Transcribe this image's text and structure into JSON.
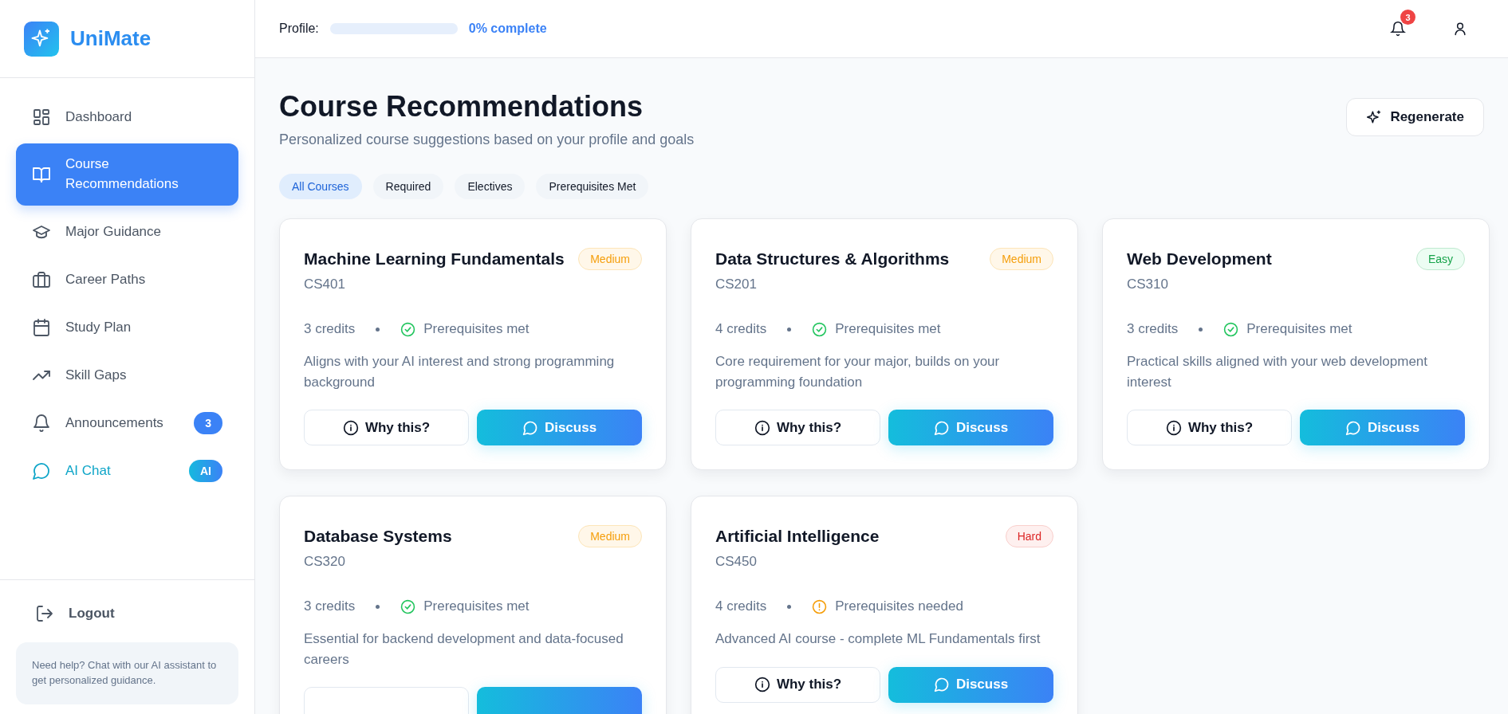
{
  "brand": {
    "name": "UniMate"
  },
  "sidebar": {
    "items": [
      {
        "label": "Dashboard",
        "selected": false
      },
      {
        "label": "Course Recommendations",
        "selected": true
      },
      {
        "label": "Major Guidance",
        "selected": false
      },
      {
        "label": "Career Paths",
        "selected": false
      },
      {
        "label": "Study Plan",
        "selected": false
      },
      {
        "label": "Skill Gaps",
        "selected": false
      },
      {
        "label": "Announcements",
        "selected": false,
        "badge": "3"
      },
      {
        "label": "AI Chat",
        "selected": false,
        "badge": "AI",
        "kind": "accent"
      }
    ],
    "logout": "Logout",
    "help": "Need help? Chat with our AI assistant to get personalized guidance."
  },
  "topbar": {
    "profile_label": "Profile:",
    "level": 0,
    "progress_text": "0% complete",
    "notification_count": "3"
  },
  "page": {
    "title": "Course Recommendations",
    "subtitle": "Personalized course suggestions based on your profile and goals",
    "action": "Regenerate"
  },
  "filters": [
    {
      "label": "All Courses",
      "selected": true
    },
    {
      "label": "Required",
      "selected": false
    },
    {
      "label": "Electives",
      "selected": false
    },
    {
      "label": "Prerequisites Met",
      "selected": false
    }
  ],
  "courses": [
    {
      "title": "Machine Learning Fundamentals",
      "difficulty": "Medium",
      "kind": "medium",
      "code": "CS401",
      "credits": "3 credits",
      "prereq": "Prerequisites met",
      "prerequisites_met": true,
      "reason": "Aligns with your AI interest and strong programming background",
      "why": "Why this?",
      "discuss": "Discuss"
    },
    {
      "title": "Data Structures & Algorithms",
      "difficulty": "Medium",
      "kind": "medium",
      "code": "CS201",
      "credits": "4 credits",
      "prereq": "Prerequisites met",
      "prerequisites_met": true,
      "reason": "Core requirement for your major, builds on your programming foundation",
      "why": "Why this?",
      "discuss": "Discuss"
    },
    {
      "title": "Web Development",
      "difficulty": "Easy",
      "kind": "easy",
      "code": "CS310",
      "credits": "3 credits",
      "prereq": "Prerequisites met",
      "prerequisites_met": true,
      "reason": "Practical skills aligned with your web development interest",
      "why": "Why this?",
      "discuss": "Discuss"
    },
    {
      "title": "Database Systems",
      "difficulty": "Medium",
      "kind": "medium",
      "code": "CS320",
      "credits": "3 credits",
      "prereq": "Prerequisites met",
      "prerequisites_met": true,
      "reason": "Essential for backend development and data-focused careers"
    },
    {
      "title": "Artificial Intelligence",
      "difficulty": "Hard",
      "kind": "hard",
      "code": "CS450",
      "credits": "4 credits",
      "prereq": "Prerequisites needed",
      "prerequisites_met": false,
      "reason": "Advanced AI course - complete ML Fundamentals first",
      "why": "Why this?",
      "discuss": "Discuss"
    }
  ]
}
